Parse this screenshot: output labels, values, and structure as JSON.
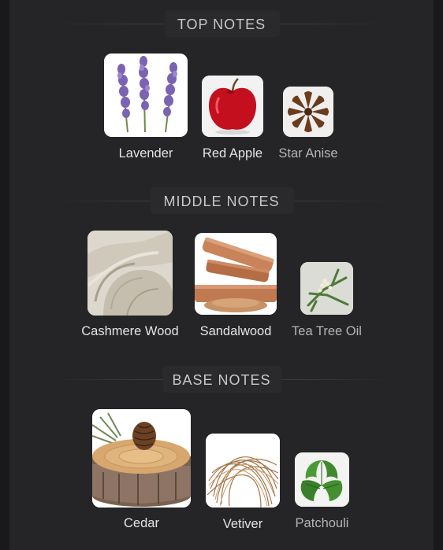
{
  "sections": [
    {
      "title": "TOP NOTES",
      "notes": [
        {
          "label": "Lavender",
          "icon": "lavender-icon"
        },
        {
          "label": "Red Apple",
          "icon": "red-apple-icon"
        },
        {
          "label": "Star Anise",
          "icon": "star-anise-icon"
        }
      ]
    },
    {
      "title": "MIDDLE NOTES",
      "notes": [
        {
          "label": "Cashmere Wood",
          "icon": "cashmere-wood-icon"
        },
        {
          "label": "Sandalwood",
          "icon": "sandalwood-icon"
        },
        {
          "label": "Tea Tree Oil",
          "icon": "tea-tree-oil-icon"
        }
      ]
    },
    {
      "title": "BASE NOTES",
      "notes": [
        {
          "label": "Cedar",
          "icon": "cedar-icon"
        },
        {
          "label": "Vetiver",
          "icon": "vetiver-icon"
        },
        {
          "label": "Patchouli",
          "icon": "patchouli-icon"
        }
      ]
    }
  ],
  "colors": {
    "background": "#19191b",
    "panel": "#252527",
    "title_text": "#c8c8cc",
    "label_text": "#e4e4e6"
  }
}
